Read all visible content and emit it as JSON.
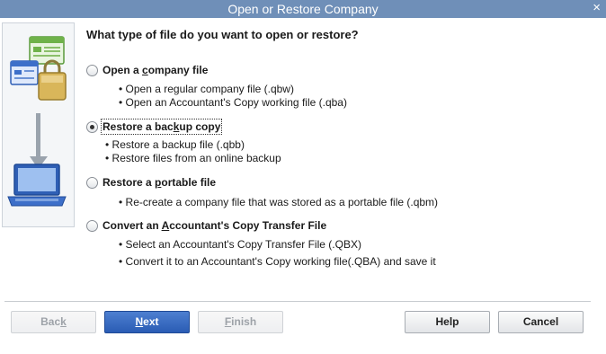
{
  "window": {
    "title": "Open or Restore Company",
    "close_glyph": "×"
  },
  "heading": "What type of file do you want to open or restore?",
  "options": [
    {
      "label_pre": "Open a ",
      "label_key": "c",
      "label_post": "ompany file",
      "checked": false,
      "bullets": [
        "• Open a regular company file (.qbw)",
        "• Open an Accountant's Copy working file (.qba)"
      ]
    },
    {
      "label_pre": "Restore a bac",
      "label_key": "k",
      "label_post": "up copy",
      "checked": true,
      "bullets": [
        "• Restore a backup file (.qbb)",
        "• Restore files from an online backup"
      ]
    },
    {
      "label_pre": "Restore a ",
      "label_key": "p",
      "label_post": "ortable file",
      "checked": false,
      "bullets": [
        "• Re-create a company file that was stored as a portable file (.qbm)"
      ]
    },
    {
      "label_pre": "Convert an ",
      "label_key": "A",
      "label_post": "ccountant's Copy Transfer File",
      "checked": false,
      "bullets": [
        "• Select an Accountant's Copy Transfer File (.QBX)",
        "• Convert it to an Accountant's Copy working file(.QBA) and save it"
      ]
    }
  ],
  "buttons": {
    "back": {
      "pre": "Bac",
      "key": "k",
      "post": "",
      "enabled": false
    },
    "next": {
      "pre": "",
      "key": "N",
      "post": "ext",
      "enabled": true
    },
    "finish": {
      "pre": "",
      "key": "F",
      "post": "inish",
      "enabled": false
    },
    "help": "Help",
    "cancel": "Cancel"
  },
  "colors": {
    "titlebar": "#6f8fb8",
    "primary_button": "#2a5cb4"
  }
}
